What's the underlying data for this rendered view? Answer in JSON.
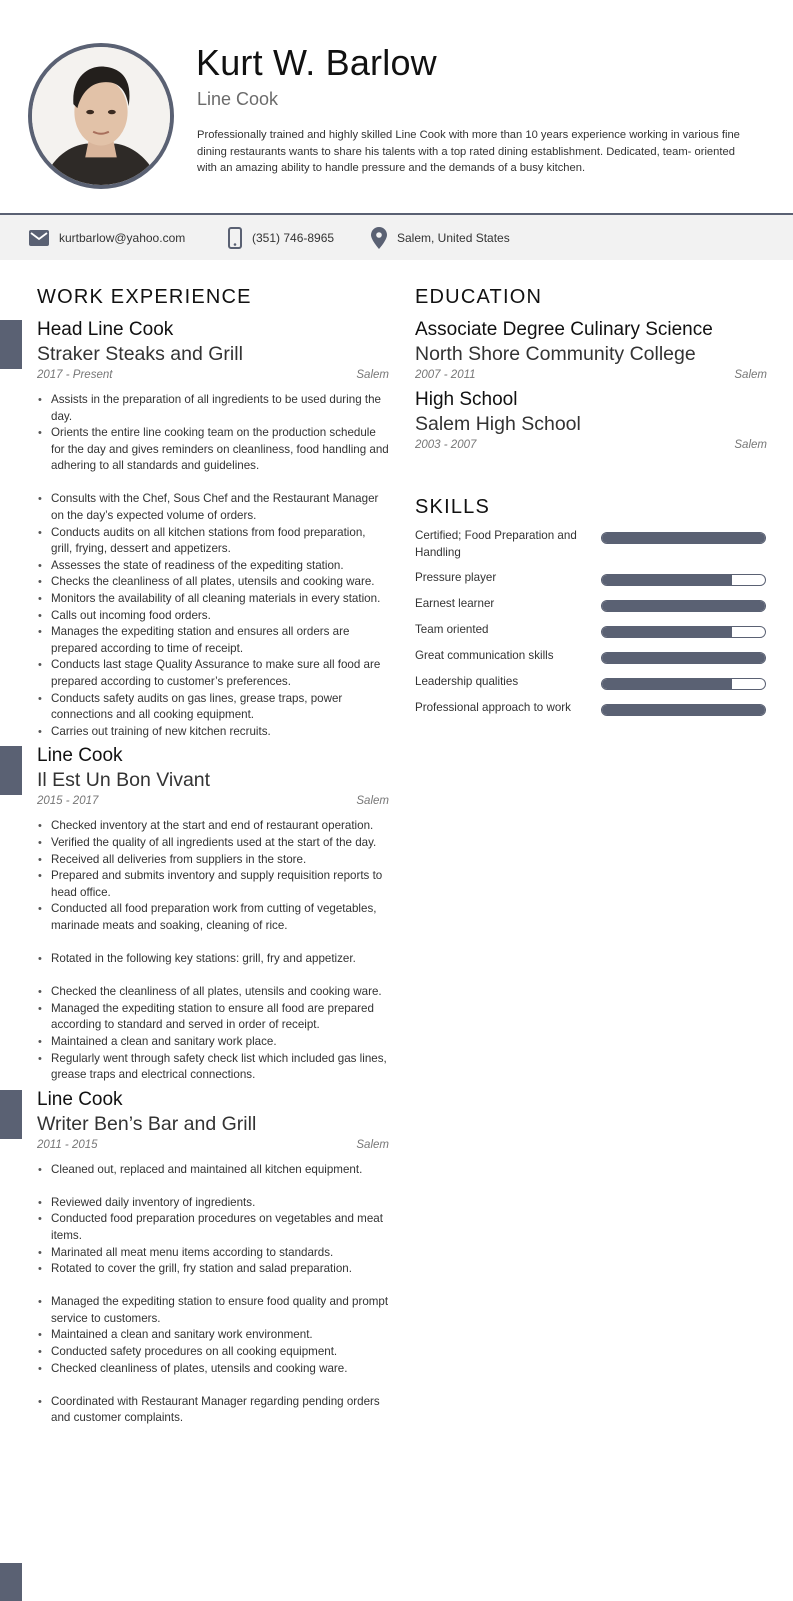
{
  "header": {
    "name": "Kurt W. Barlow",
    "title": "Line Cook",
    "summary": "Professionally trained and highly skilled Line Cook with more than 10 years experience working in various fine dining restaurants wants to share his talents with a top rated dining establishment. Dedicated, team- oriented with an amazing ability to handle pressure and the demands of a busy kitchen.",
    "photo_icon": "profile-photo"
  },
  "contact": {
    "email": "kurtbarlow@yahoo.com",
    "phone": "(351) 746-8965",
    "location": "Salem, United States",
    "icons": [
      "envelope-icon",
      "phone-icon",
      "map-pin-icon"
    ]
  },
  "colors": {
    "accent": "#5a6173",
    "contact_bg": "#f2f2f2"
  },
  "work": {
    "heading": "WORK EXPERIENCE",
    "jobs": [
      {
        "role": "Head Line Cook",
        "company": "Straker Steaks and Grill",
        "dates": "2017 - Present",
        "location": "Salem",
        "groups": [
          [
            "Assists in the preparation of all ingredients to be used during the day.",
            "Orients the entire line cooking team on the production schedule for the day and gives reminders on cleanliness, food handling and adhering to all standards and guidelines."
          ],
          [
            "Consults with the Chef, Sous Chef and the Restaurant Manager on the day’s expected volume of orders.",
            "Conducts audits on all kitchen stations from food preparation, grill, frying, dessert and appetizers.",
            "Assesses the state of readiness of the expediting station.",
            "Checks the cleanliness of all plates, utensils and cooking ware.",
            "Monitors the availability of all cleaning materials in every station.",
            "Calls out incoming food orders.",
            "Manages the expediting station and ensures all orders are prepared according to time of receipt.",
            "Conducts last stage Quality Assurance to make sure all food are prepared according to customer’s preferences.",
            "Conducts safety audits on gas lines, grease traps, power connections and all cooking equipment.",
            "Carries out training of new kitchen recruits."
          ]
        ]
      },
      {
        "role": "Line Cook",
        "company": "Il Est Un Bon Vivant",
        "dates": "2015 - 2017",
        "location": "Salem",
        "groups": [
          [
            "Checked inventory at the start and end of restaurant operation.",
            "Verified the quality of all ingredients used at the start of the day.",
            "Received all deliveries from suppliers in the store.",
            "Prepared and submits inventory and supply requisition reports to head office.",
            "Conducted all food preparation work from cutting of vegetables, marinade meats and soaking, cleaning of rice."
          ],
          [
            "Rotated in the following key stations: grill, fry and appetizer."
          ],
          [
            "Checked the cleanliness of all plates, utensils and cooking ware.",
            "Managed the expediting station to ensure all food are prepared according to standard and served in order of receipt.",
            "Maintained a clean and sanitary work place.",
            "Regularly went through safety check list which included gas lines, grease traps and electrical connections."
          ]
        ]
      },
      {
        "role": "Line Cook",
        "company": "Writer Ben’s Bar and Grill",
        "dates": "2011 - 2015",
        "location": "Salem",
        "groups": [
          [
            "Cleaned out, replaced and maintained all kitchen equipment."
          ],
          [
            "Reviewed daily inventory of ingredients.",
            "Conducted food preparation procedures on vegetables and meat items.",
            "Marinated all meat menu items according to standards.",
            "Rotated to cover the grill, fry station and salad preparation."
          ],
          [
            "Managed the expediting station to ensure food quality and prompt service to customers.",
            "Maintained a clean and sanitary work environment.",
            "Conducted safety procedures on all cooking equipment.",
            "Checked cleanliness of plates, utensils and cooking ware."
          ],
          [
            "Coordinated with Restaurant Manager regarding pending orders and customer complaints."
          ]
        ]
      }
    ]
  },
  "education": {
    "heading": "EDUCATION",
    "items": [
      {
        "degree": "Associate Degree Culinary Science",
        "school": "North Shore Community College",
        "dates": "2007 - 2011",
        "location": "Salem"
      },
      {
        "degree": "High School",
        "school": "Salem High School",
        "dates": "2003 - 2007",
        "location": "Salem"
      }
    ]
  },
  "skills": {
    "heading": "SKILLS",
    "items": [
      {
        "name": "Certified; Food Preparation and Handling",
        "level": 1.0
      },
      {
        "name": "Pressure player",
        "level": 0.8
      },
      {
        "name": "Earnest learner",
        "level": 1.0
      },
      {
        "name": "Team oriented",
        "level": 0.8
      },
      {
        "name": "Great communication skills",
        "level": 1.0
      },
      {
        "name": "Leadership qualities",
        "level": 0.8
      },
      {
        "name": "Professional approach to work",
        "level": 1.0
      }
    ]
  }
}
